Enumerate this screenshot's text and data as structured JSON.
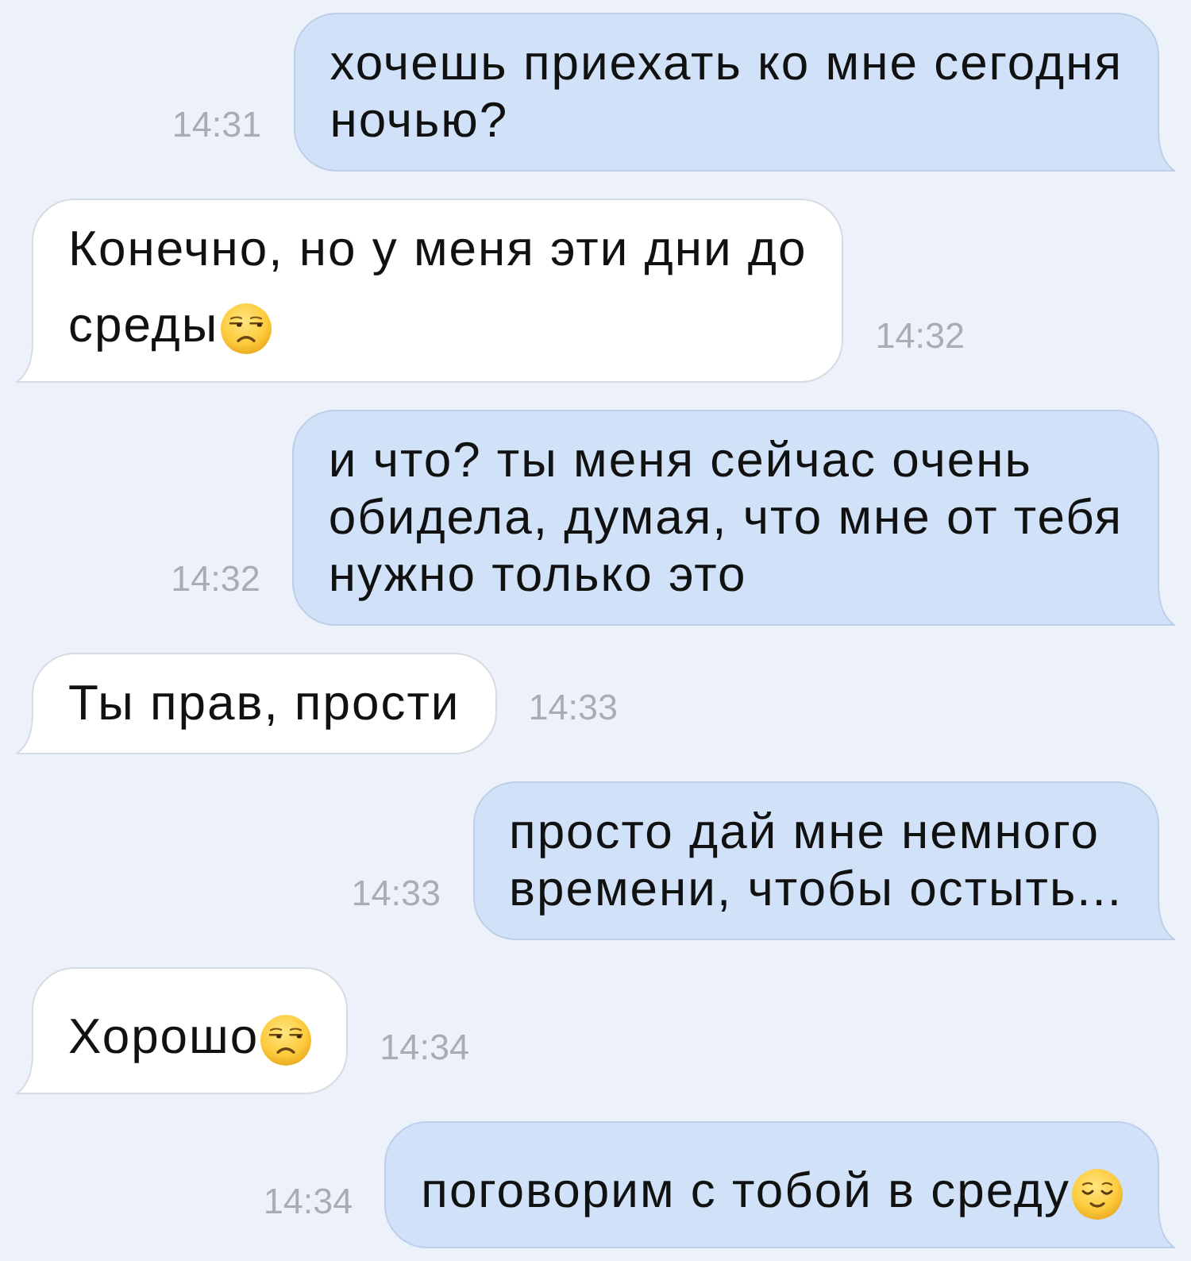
{
  "messages": [
    {
      "kind": "outgoing",
      "lines": [
        "хочешь приехать ко мне сегодня",
        "ночью?"
      ],
      "time": "14:31"
    },
    {
      "kind": "incoming",
      "lines": [
        "Конечно, но у меня эти дни до",
        "среды"
      ],
      "emoji": {
        "kind": "unamused"
      },
      "time": "14:32"
    },
    {
      "kind": "outgoing",
      "lines": [
        "и что? ты меня сейчас очень",
        "обидела, думая, что мне от тебя",
        "нужно только это"
      ],
      "time": "14:32"
    },
    {
      "kind": "incoming",
      "lines": [
        "Ты прав, прости"
      ],
      "time": "14:33"
    },
    {
      "kind": "outgoing",
      "lines": [
        "просто дай мне немного",
        "времени, чтобы остыть..."
      ],
      "time": "14:33"
    },
    {
      "kind": "incoming",
      "lines": [
        "Хорошо"
      ],
      "emoji": {
        "kind": "unamused"
      },
      "time": "14:34"
    },
    {
      "kind": "outgoing",
      "lines": [
        "поговорим с тобой в среду"
      ],
      "emoji": {
        "kind": "relieved"
      },
      "time": "14:34"
    }
  ]
}
